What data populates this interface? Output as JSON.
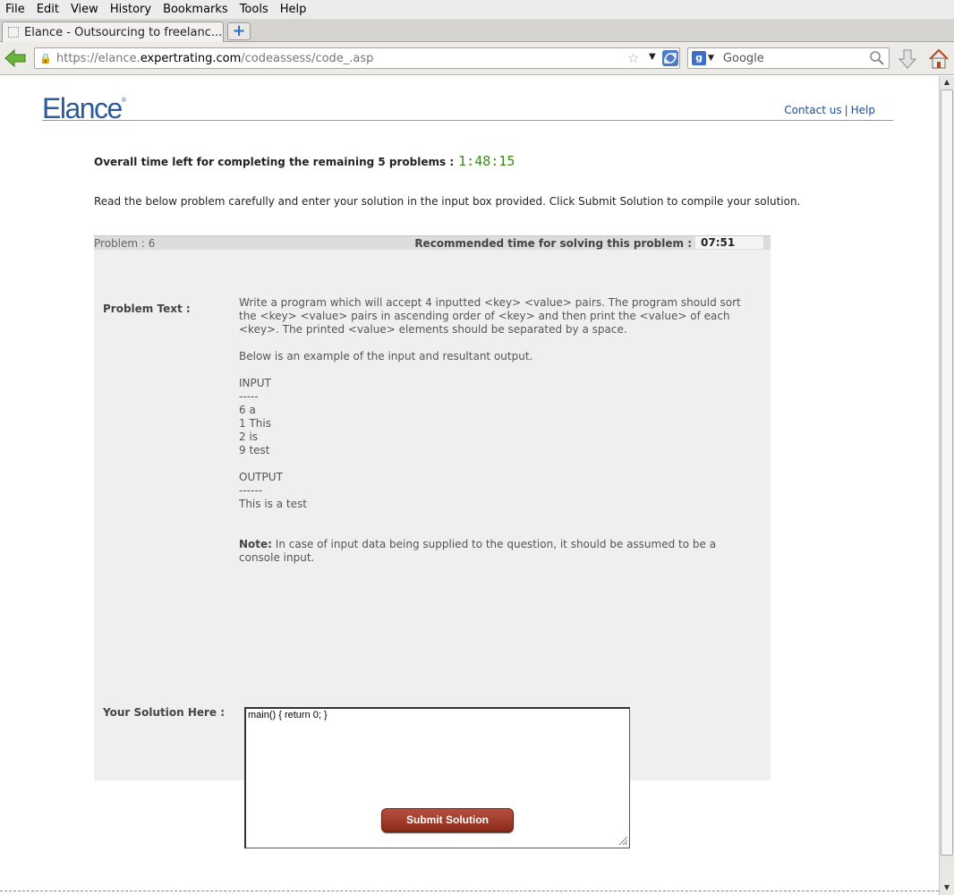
{
  "menu": [
    "File",
    "Edit",
    "View",
    "History",
    "Bookmarks",
    "Tools",
    "Help"
  ],
  "tab": {
    "title": "Elance - Outsourcing to freelanc..."
  },
  "navbar": {
    "url_prefix": "https://elance.",
    "url_domain": "expertrating.com",
    "url_path": "/codeassess/code_.asp",
    "search_placeholder": "Google"
  },
  "page": {
    "logo": "Elance",
    "contact": "Contact us",
    "help": "Help",
    "time_label": "Overall time left for completing the remaining 5 problems :",
    "time_value": "1:48:15",
    "instructions": "Read the below problem carefully and enter your solution in the input box provided. Click Submit Solution to compile your solution.",
    "problem_number": "Problem : 6",
    "recommended_label": "Recommended time for solving this problem :",
    "recommended_time": "07:51",
    "problem_text_label": "Problem Text :",
    "problem_lines": {
      "intro": "Write a program which will accept 4 inputted <key> <value> pairs. The program should sort the <key> <value> pairs in ascending order of <key> and then print the <value> of each <key>. The printed <value> elements should be separated by a space.",
      "example": "Below is an example of the input and resultant output.",
      "input_head": "INPUT",
      "input_rule": "-----",
      "input_1": "6 a",
      "input_2": "1 This",
      "input_3": "2 is",
      "input_4": "9 test",
      "output_head": "OUTPUT",
      "output_rule": "------",
      "output_1": "This is a test",
      "note_label": "Note:",
      "note_text": " In case of input data being supplied to the question, it should be assumed to be a console input."
    },
    "solution_label": "Your Solution Here :",
    "solution_value": "main() { return 0; }",
    "submit_label": "Submit Solution"
  }
}
